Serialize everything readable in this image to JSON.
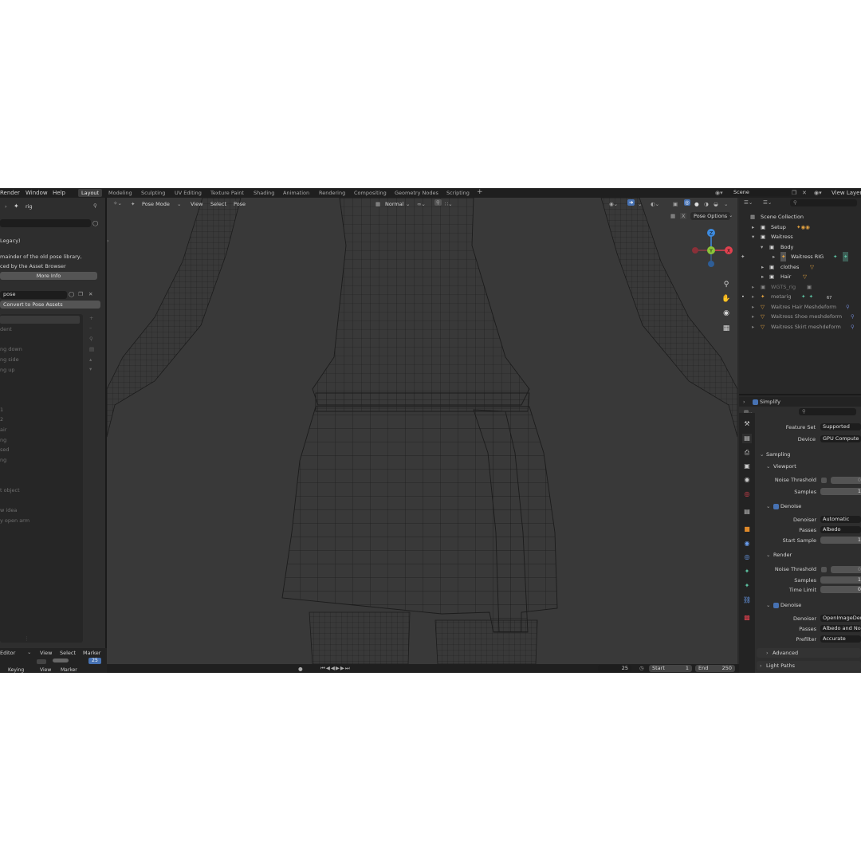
{
  "topbar": {
    "menus": [
      "Render",
      "Window",
      "Help"
    ],
    "workspaces": [
      "Layout",
      "Modeling",
      "Sculpting",
      "UV Editing",
      "Texture Paint",
      "Shading",
      "Animation",
      "Rendering",
      "Compositing",
      "Geometry Nodes",
      "Scripting"
    ],
    "add_tab": "+",
    "scene_name": "Scene",
    "view_layer": "View Layer"
  },
  "left_panel": {
    "breadcrumb": "rig",
    "legacy_header": "Legacy)",
    "notice_line1": "mainder of the old pose library,",
    "notice_line2": "ced by the Asset Browser",
    "more_info": "More Info",
    "pose_name": "pose",
    "convert_button": "Convert to Pose Assets",
    "pose_list": [
      "dent",
      "ng down",
      "ng side",
      "ng up",
      "1",
      "2",
      "air",
      "ng",
      "sed",
      "ng",
      "t object",
      "w idea",
      "y open arm"
    ]
  },
  "bottom_editor": {
    "editor_name": "Editor",
    "menus": [
      "View",
      "Select",
      "Marker"
    ],
    "row2_menus": [
      "Keying",
      "View",
      "Marker"
    ],
    "frame_badge": "25"
  },
  "viewport": {
    "mode": "Pose Mode",
    "menus": [
      "View",
      "Select",
      "Pose"
    ],
    "orientation": "Normal",
    "pose_options": "Pose Options",
    "gizmo": {
      "x": "X",
      "y": "Y",
      "z": "Z"
    }
  },
  "timeline": {
    "current_frame": "25",
    "start_label": "Start",
    "start_value": "1",
    "end_label": "End",
    "end_value": "250"
  },
  "outliner": {
    "root": "Scene Collection",
    "items": [
      {
        "label": "Setup",
        "indent": 0
      },
      {
        "label": "Waitress",
        "indent": 0
      },
      {
        "label": "Body",
        "indent": 1
      },
      {
        "label": "Waitress RIG",
        "indent": 2
      },
      {
        "label": "clothes",
        "indent": 1
      },
      {
        "label": "Hair",
        "indent": 1
      },
      {
        "label": "WGTS_rig",
        "indent": 0
      },
      {
        "label": "metarig",
        "indent": 0
      },
      {
        "label": "Waitres Hair Meshdeform",
        "indent": 0
      },
      {
        "label": "Waitress Shoe meshdeform",
        "indent": 0
      },
      {
        "label": "Waitress Skirt meshdeform",
        "indent": 0
      }
    ],
    "metarig_count": "67"
  },
  "properties": {
    "simplify": "Simplify",
    "feature_set_label": "Feature Set",
    "feature_set_value": "Supported",
    "device_label": "Device",
    "device_value": "GPU Compute",
    "sampling": "Sampling",
    "viewport": "Viewport",
    "noise_threshold": "Noise Threshold",
    "samples": "Samples",
    "samples_value": "1",
    "denoise": "Denoise",
    "denoiser_label": "Denoiser",
    "denoiser_value_viewport": "Automatic",
    "passes_label": "Passes",
    "passes_value_viewport": "Albedo",
    "start_sample": "Start Sample",
    "start_sample_value": "1",
    "render": "Render",
    "render_samples_value": "1",
    "time_limit": "Time Limit",
    "time_limit_value": "0",
    "denoiser_value_render": "OpenImageDen",
    "passes_value_render": "Albedo and Nor",
    "prefilter_label": "Prefilter",
    "prefilter_value": "Accurate",
    "advanced": "Advanced",
    "light_paths": "Light Paths"
  },
  "colors": {
    "accent_blue": "#4772b3",
    "axis_x": "#e0414f",
    "axis_y": "#8bc43a",
    "axis_z": "#3d8be0",
    "mesh_wire": "#1c1c1c",
    "background": "#393939"
  }
}
